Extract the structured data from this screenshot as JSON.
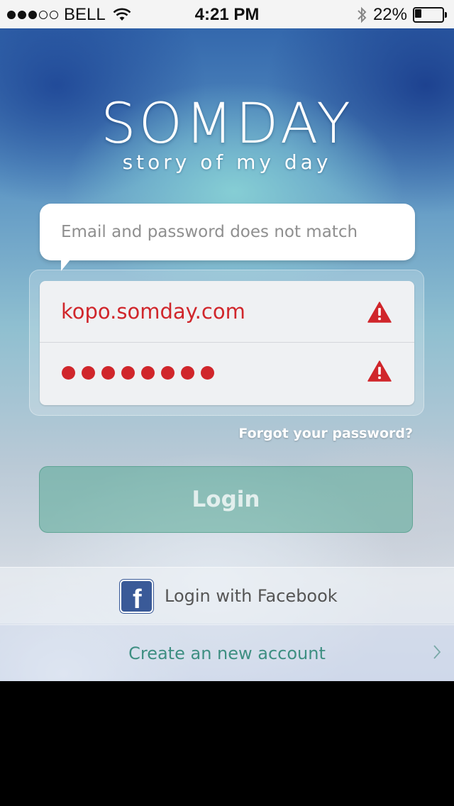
{
  "status_bar": {
    "carrier": "BELL",
    "time": "4:21 PM",
    "battery": "22%",
    "signal_bars_filled": 3,
    "signal_bars_total": 5
  },
  "app": {
    "title": "SOMDAY",
    "tagline": "story of my day"
  },
  "error": {
    "message": "Email and password does not match"
  },
  "form": {
    "email_value": "kopo.somday.com",
    "password_mask_length": 8,
    "field_error_icon": "warning-triangle-icon",
    "error_color": "#d0262b"
  },
  "links": {
    "forgot_password": "Forgot your password?"
  },
  "buttons": {
    "login": "Login",
    "login_facebook": "Login with Facebook",
    "create_account": "Create an new account"
  },
  "colors": {
    "accent": "#3e8f82",
    "facebook": "#3a5a98"
  }
}
